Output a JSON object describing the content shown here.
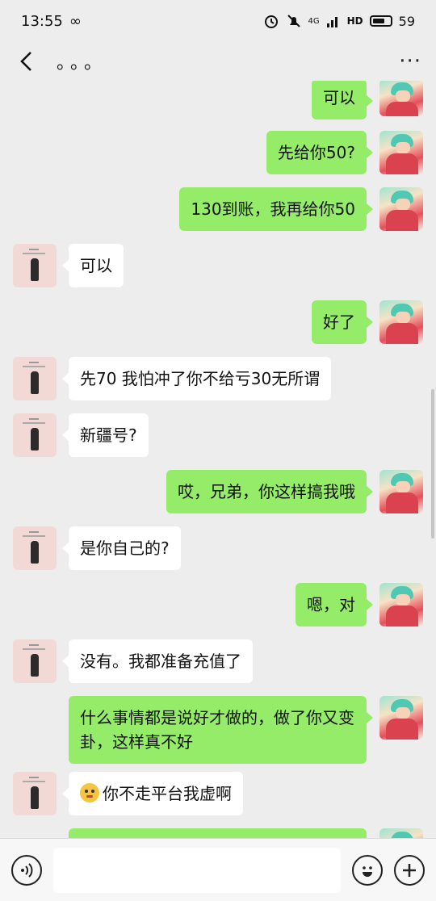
{
  "status_bar": {
    "time": "13:55",
    "extra_icon": "∞",
    "network": "4G",
    "hd": "HD",
    "battery": "59"
  },
  "header": {
    "title": "。。。",
    "more": "···"
  },
  "messages": [
    {
      "side": "me",
      "text": "可以"
    },
    {
      "side": "me",
      "text": "先给你50?"
    },
    {
      "side": "me",
      "text": "130到账，我再给你50"
    },
    {
      "side": "other",
      "text": "可以"
    },
    {
      "side": "me",
      "text": "好了"
    },
    {
      "side": "other",
      "text": "先70 我怕冲了你不给亏30无所谓"
    },
    {
      "side": "other",
      "text": "新疆号?"
    },
    {
      "side": "me",
      "text": "哎，兄弟，你这样搞我哦"
    },
    {
      "side": "other",
      "text": "是你自己的?"
    },
    {
      "side": "me",
      "text": "嗯，对"
    },
    {
      "side": "other",
      "text": "没有。我都准备充值了"
    },
    {
      "side": "me",
      "text": "什么事情都是说好才做的，做了你又变卦，这样真不好"
    },
    {
      "side": "other",
      "text": "你不走平台我虚啊",
      "emoji": "flushed-face-emoji"
    },
    {
      "side": "me",
      "text": ""
    }
  ],
  "input": {
    "placeholder": ""
  },
  "icons": [
    "back-arrow-icon",
    "more-icon",
    "voice-icon",
    "emoji-icon",
    "plus-icon"
  ],
  "colors": {
    "my_bubble": "#95ec69",
    "their_bubble": "#ffffff",
    "background": "#ededed"
  }
}
